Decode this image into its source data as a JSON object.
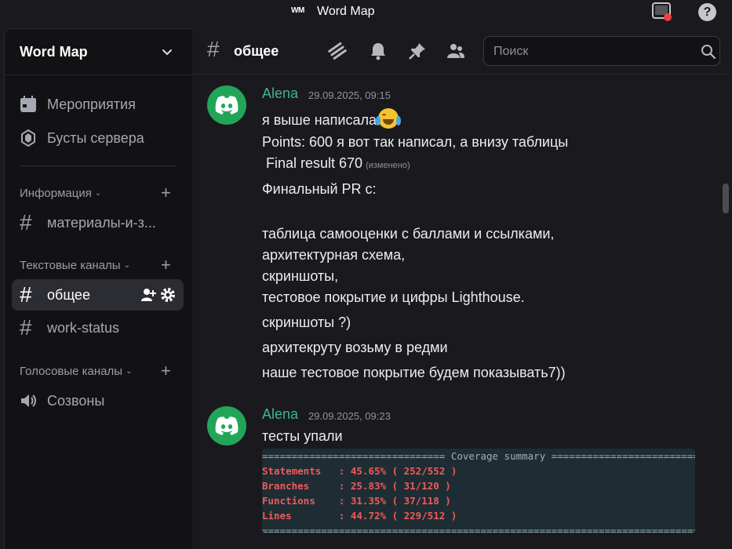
{
  "window": {
    "badge": "WM",
    "title": "Word Map"
  },
  "server": {
    "name": "Word Map"
  },
  "sidebar": {
    "top_items": [
      {
        "label": "Мероприятия",
        "icon": "calendar-icon"
      },
      {
        "label": "Бусты сервера",
        "icon": "boost-icon"
      }
    ],
    "categories": [
      {
        "label": "Информация",
        "channels": [
          {
            "label": "материалы-и-з...",
            "type": "text"
          }
        ]
      },
      {
        "label": "Текстовые каналы",
        "channels": [
          {
            "label": "общее",
            "type": "text",
            "active": true
          },
          {
            "label": "work-status",
            "type": "text"
          }
        ]
      },
      {
        "label": "Голосовые каналы",
        "channels": [
          {
            "label": "Созвоны",
            "type": "voice"
          }
        ]
      }
    ]
  },
  "channel": {
    "name": "общее",
    "search_placeholder": "Поиск"
  },
  "messages": [
    {
      "author": "Alena",
      "timestamp": "29.09.2025, 09:15",
      "lines": [
        "я выше написала",
        "Points: 600 я вот так написал, а внизу таблицы",
        " Final result 670",
        "Финальный PR с:",
        "таблица самооценки с баллами и ссылками,",
        "архитектурная схема,",
        "скриншоты,",
        "тестовое покрытие и цифры Lighthouse.",
        "скриншоты ?)",
        "архитекруту возьму в редми",
        "наше тестовое покрытие будем показывать7))"
      ],
      "edited": "(изменено)"
    },
    {
      "author": "Alena",
      "timestamp": "29.09.2025, 09:23",
      "lines": [
        "тесты упали"
      ],
      "code": [
        "=============================== Coverage summary ===============================",
        "Statements   : 45.65% ( 252/552 )",
        "Branches     : 25.83% ( 31/120 )",
        "Functions    : 31.35% ( 37/118 )",
        "Lines        : 44.72% ( 229/512 )",
        "================================================================================"
      ]
    }
  ],
  "colors": {
    "author": "#3fb58f",
    "avatar": "#23a559",
    "coverage_red": "#ef5a5a"
  }
}
